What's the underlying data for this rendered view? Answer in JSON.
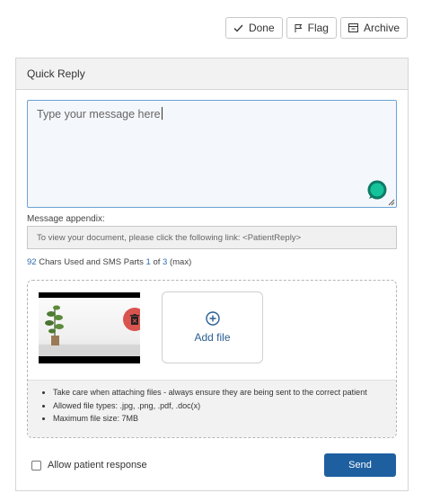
{
  "toolbar": {
    "done_label": "Done",
    "flag_label": "Flag",
    "archive_label": "Archive"
  },
  "quick_reply": {
    "title": "Quick Reply",
    "message_placeholder": "Type your message here",
    "appendix_label": "Message appendix:",
    "appendix_text": "To view your document, please click the following link: <PatientReply>",
    "chars": {
      "count": "92",
      "text1": " Chars Used and SMS Parts ",
      "parts": "1",
      "text2": " of ",
      "max_parts": "3",
      "text3": " (max)"
    },
    "attachments": {
      "add_file_label": "Add file",
      "notes": [
        "Take care when attaching files - always ensure they are being sent to the correct patient",
        "Allowed file types: .jpg, .png, .pdf, .doc(x)",
        "Maximum file size: 7MB"
      ]
    },
    "allow_response_label": "Allow patient response",
    "send_label": "Send"
  },
  "colors": {
    "primary": "#1e5fa0",
    "delete": "#d9534f",
    "link": "#2b6cb0",
    "grammar": "#15c39a"
  }
}
